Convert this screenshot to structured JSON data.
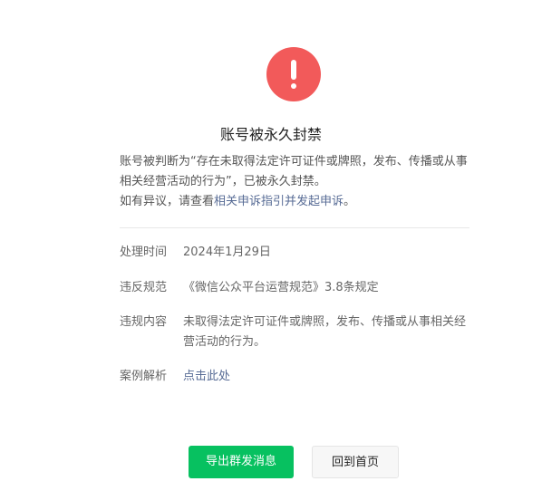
{
  "notice": {
    "title": "账号被永久封禁",
    "description_prefix": "账号被判断为“存在未取得法定许可证件或牌照，发布、传播或从事相关经营活动的行为”，已被永久封禁。",
    "appeal_prefix": "如有异议，请查看",
    "appeal_link": "相关申诉指引并发起申诉",
    "appeal_suffix": "。"
  },
  "details": [
    {
      "label": "处理时间",
      "value": "2024年1月29日"
    },
    {
      "label": "违反规范",
      "value": "《微信公众平台运营规范》3.8条规定"
    },
    {
      "label": "违规内容",
      "value": "未取得法定许可证件或牌照，发布、传播或从事相关经营活动的行为。"
    },
    {
      "label": "案例解析",
      "value": "点击此处"
    }
  ],
  "buttons": {
    "export_label": "导出群发消息",
    "home_label": "回到首页"
  },
  "colors": {
    "warning": "#f25a5a",
    "link": "#576b95",
    "primary": "#07c160"
  },
  "icons": {
    "status": "exclamation-circle-icon"
  }
}
